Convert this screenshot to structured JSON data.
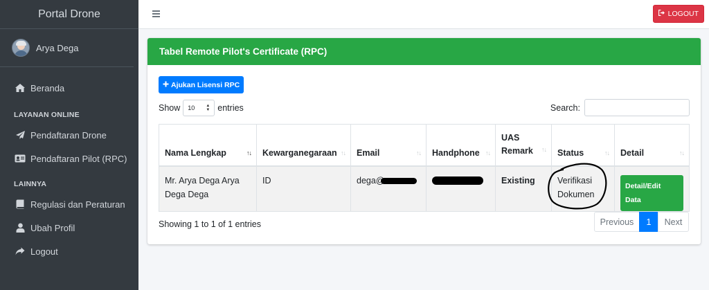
{
  "sidebar": {
    "brand": "Portal Drone",
    "user_name": "Arya Dega",
    "nav": [
      {
        "label": "Beranda",
        "icon": "home-icon"
      },
      {
        "label": "Pendaftaran Drone",
        "icon": "paper-plane-icon"
      },
      {
        "label": "Pendaftaran Pilot (RPC)",
        "icon": "id-card-icon"
      },
      {
        "label": "Regulasi dan Peraturan",
        "icon": "book-icon"
      },
      {
        "label": "Ubah Profil",
        "icon": "user-icon"
      },
      {
        "label": "Logout",
        "icon": "share-icon"
      }
    ],
    "headers": [
      "LAYANAN ONLINE",
      "LAINNYA"
    ]
  },
  "topbar": {
    "logout_label": "LOGOUT"
  },
  "card": {
    "title": "Tabel Remote Pilot's Certificate (RPC)",
    "add_button": "Ajukan Lisensi RPC",
    "show_label": "Show",
    "entries_label": "entries",
    "page_length": "10",
    "search_label": "Search:",
    "search_value": ""
  },
  "table": {
    "columns": [
      "Nama Lengkap",
      "Kewarganegaraan",
      "Email",
      "Handphone",
      "UAS Remark",
      "Status",
      "Detail"
    ],
    "rows": [
      {
        "nama": "Mr. Arya Dega Arya Dega Dega",
        "kewarganegaraan": "ID",
        "email": "dega@",
        "handphone": "",
        "uas_remark": "Existing",
        "status": "Verifikasi Dokumen",
        "detail_button": "Detail/Edit Data"
      }
    ]
  },
  "footer": {
    "info": "Showing 1 to 1 of 1 entries",
    "previous": "Previous",
    "page": "1",
    "next": "Next"
  },
  "colors": {
    "sidebar_bg": "#343a40",
    "header_green": "#28a745",
    "primary_blue": "#007bff",
    "danger_red": "#dc3545"
  }
}
